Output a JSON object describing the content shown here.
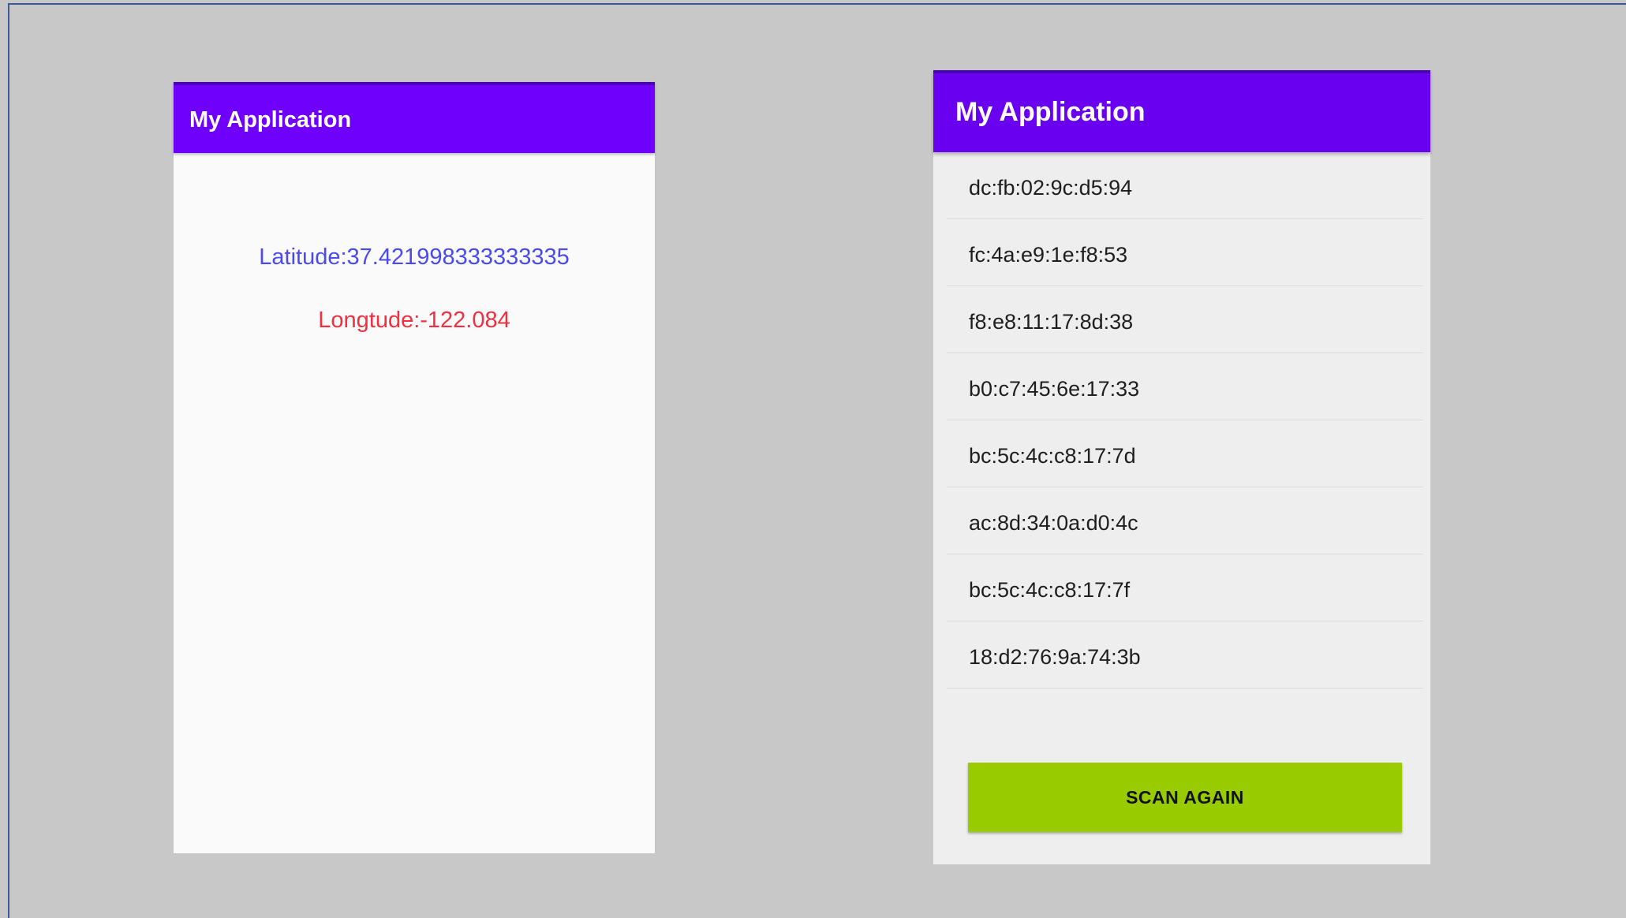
{
  "screen1": {
    "app_title": "My Application",
    "latitude_text": "Latitude:37.421998333333335",
    "longitude_text": "Longtude:-122.084"
  },
  "screen2": {
    "app_title": "My Application",
    "mac_addresses": [
      "dc:fb:02:9c:d5:94",
      "fc:4a:e9:1e:f8:53",
      "f8:e8:11:17:8d:38",
      "b0:c7:45:6e:17:33",
      "bc:5c:4c:c8:17:7d",
      "ac:8d:34:0a:d0:4c",
      "bc:5c:4c:c8:17:7f",
      "18:d2:76:9a:74:3b"
    ],
    "scan_button_label": "SCAN AGAIN"
  },
  "colors": {
    "app_bar": "#6f00fb",
    "latitude": "#4a4af0",
    "longitude": "#f03040",
    "scan_button": "#99cc00"
  }
}
